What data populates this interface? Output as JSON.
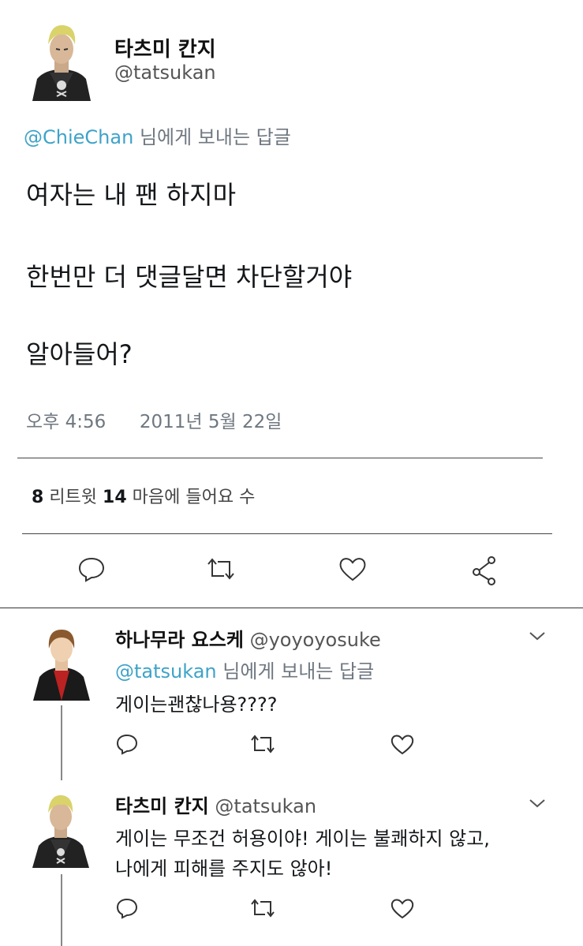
{
  "main_tweet": {
    "display_name": "타츠미 칸지",
    "handle": "@tatsukan",
    "reply_to": {
      "mention": "@ChieChan",
      "suffix": "님에게 보내는 답글"
    },
    "lines": [
      "여자는 내 팬 하지마",
      "한번만 더 댓글달면 차단할거야",
      "알아들어?"
    ],
    "time": "오후 4:56",
    "date": "2011년 5월 22일",
    "stats": {
      "retweets": "8",
      "retweets_label": "리트윗",
      "likes": "14",
      "likes_label": "마음에 들어요 수"
    }
  },
  "replies": [
    {
      "display_name": "하나무라 요스케",
      "handle": "@yoyoyosuke",
      "reply_to": {
        "mention": "@tatsukan",
        "suffix": "님에게 보내는 답글"
      },
      "text": "게이는괜찮나용????"
    },
    {
      "display_name": "타츠미 칸지",
      "handle": "@tatsukan",
      "text_lines": [
        "게이는 무조건 허용이야! 게이는 불쾌하지 않고,",
        "나에게 피해를 주지도 않아!"
      ]
    }
  ],
  "colors": {
    "mention": "#3ea3c8",
    "text": "#14171a",
    "meta": "#6f7780"
  },
  "icons": [
    "reply-icon",
    "retweet-icon",
    "like-icon",
    "share-icon",
    "chevron-down-icon"
  ]
}
